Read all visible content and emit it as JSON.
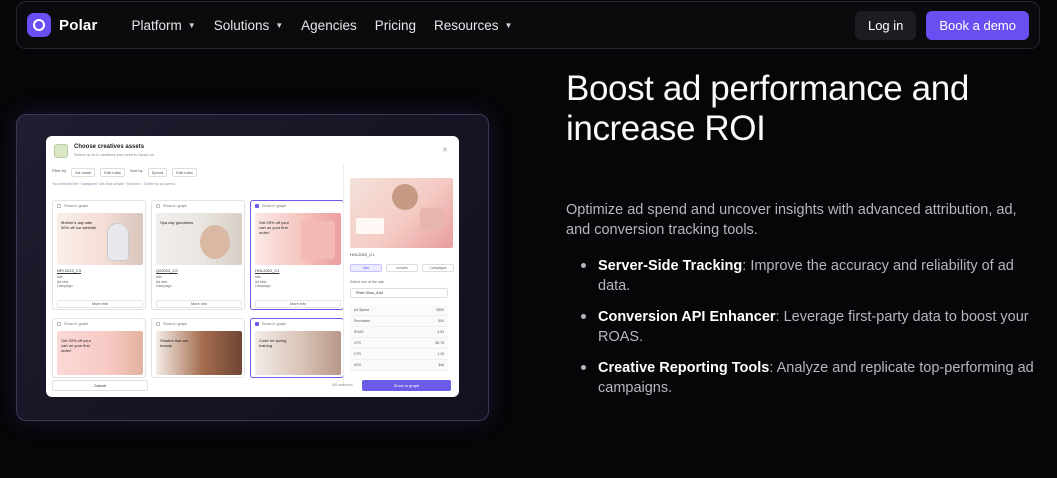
{
  "nav": {
    "brand": "Polar",
    "items": [
      {
        "label": "Platform",
        "dropdown": true
      },
      {
        "label": "Solutions",
        "dropdown": true
      },
      {
        "label": "Agencies",
        "dropdown": false
      },
      {
        "label": "Pricing",
        "dropdown": false
      },
      {
        "label": "Resources",
        "dropdown": true
      }
    ],
    "login": "Log in",
    "demo": "Book a demo"
  },
  "hero": {
    "title": "Boost ad performance and increase ROI",
    "lead": "Optimize ad spend and uncover insights with advanced attribution, ad, and conversion tracking tools.",
    "bullets": [
      {
        "title": "Server-Side Tracking",
        "text": ": Improve the accuracy and reliability of ad data."
      },
      {
        "title": "Conversion API Enhancer",
        "text": ": Leverage first-party data to boost your ROAS."
      },
      {
        "title": "Creative Reporting Tools",
        "text": ": Analyze and replicate top-performing ad campaigns."
      }
    ]
  },
  "preview": {
    "title": "Choose creatives assets",
    "subtitle": "Select up to 6 creatives you need to focus on",
    "filter_by": "Filter by",
    "sort_by": "Sort by",
    "chips": [
      "Ad name",
      "Edit rules",
      "Spend",
      "Edit rules"
    ],
    "note": "You selected the \"Instagram\" ads that contain \"Summer\". Sorted by ad spend.",
    "show_in_graph": "Show in graph",
    "more_info": "More info",
    "cards": [
      {
        "name": "NPL2023_C3",
        "caption": "Mother's day sale 30% off our website",
        "selected": false
      },
      {
        "name": "Q22023_C2",
        "caption": "Spa day goodness",
        "selected": false
      },
      {
        "name": "HOL2022_C1",
        "caption": "Get 20% off your cart on your first order!",
        "selected": true
      },
      {
        "name": "",
        "caption": "Get 20% off your cart on your first order!",
        "selected": false
      },
      {
        "name": "",
        "caption": "Shades that are beauty",
        "selected": false
      },
      {
        "name": "",
        "caption": "Code for spring training",
        "selected": true
      }
    ],
    "card_rows": [
      "Ads",
      "Ad sets",
      "Campaign"
    ],
    "side": {
      "name": "HOL2022_C1",
      "tabs": [
        "Ads",
        "Ad sets",
        "Campaigns"
      ],
      "select_label": "Select one of the ads",
      "select_value": "Pixel Glow_Ad4",
      "rows": [
        {
          "k": "Ad Spend",
          "v": "$305"
        },
        {
          "k": "Purchases",
          "v": "500"
        },
        {
          "k": "ROAS",
          "v": "3.54"
        },
        {
          "k": "CPC",
          "v": "$0.78"
        },
        {
          "k": "CTR",
          "v": "1.26"
        },
        {
          "k": "AOV",
          "v": "$46"
        }
      ]
    },
    "cancel": "Cancel",
    "count": "3/6 selected",
    "show": "Show in graph"
  },
  "colors": {
    "accent": "#6a4ef2",
    "background": "#060608",
    "muted_text": "#b6b6bf"
  }
}
